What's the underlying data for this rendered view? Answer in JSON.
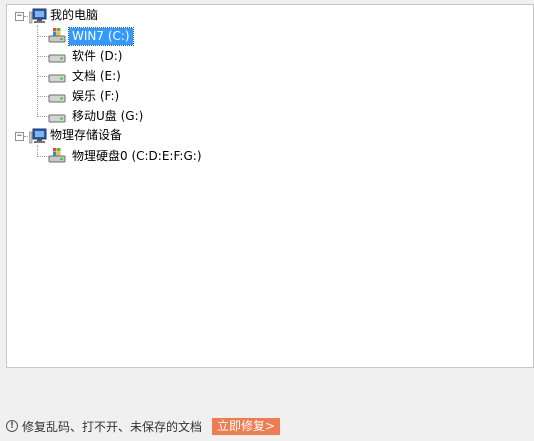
{
  "tree": {
    "computer": {
      "label": "我的电脑",
      "icon": "computer-icon",
      "children": [
        {
          "label": "WIN7  (C:)",
          "icon": "windows-drive-icon",
          "selected": true
        },
        {
          "label": "软件  (D:)",
          "icon": "drive-icon"
        },
        {
          "label": "文档  (E:)",
          "icon": "drive-icon"
        },
        {
          "label": "娱乐  (F:)",
          "icon": "drive-icon"
        },
        {
          "label": "移动U盘  (G:)",
          "icon": "drive-icon"
        }
      ]
    },
    "physical": {
      "label": "物理存储设备",
      "icon": "computer-icon",
      "children": [
        {
          "label": "物理硬盘0  (C:D:E:F:G:)",
          "icon": "windows-drive-icon"
        }
      ]
    },
    "expander_symbol": "−"
  },
  "footer": {
    "info_glyph": "!",
    "message": "修复乱码、打不开、未保存的文档",
    "fix_button": "立即修复>"
  },
  "colors": {
    "selection": "#3399ff",
    "button": "#f07c4f"
  }
}
